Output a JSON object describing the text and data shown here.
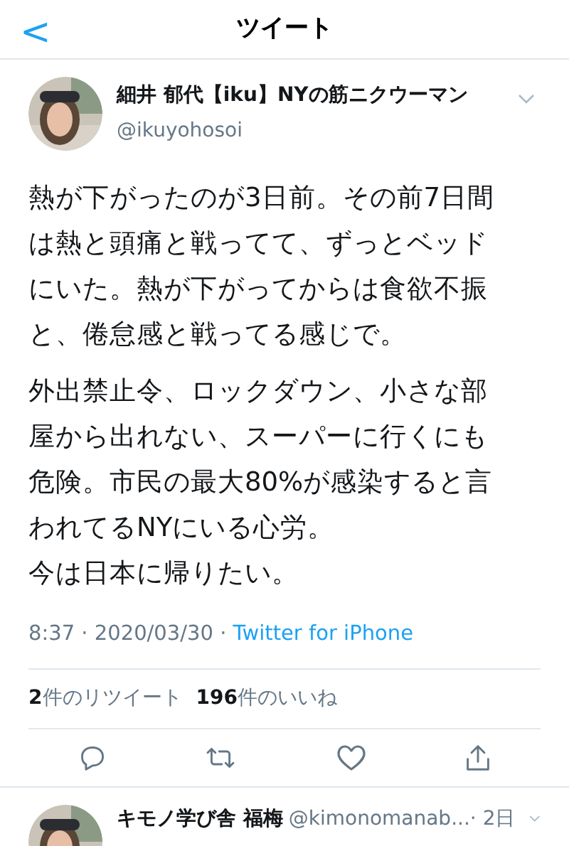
{
  "header": {
    "back": "<",
    "title": "ツイート"
  },
  "tweet": {
    "author": {
      "name": "細井 郁代【iku】NYの筋ニクウーマン",
      "handle": "@ikuyohosoi"
    },
    "paragraphs": [
      [
        "熱が下がったのが3日前。その前7日間は熱と頭痛と戦ってて、ずっとベッドにいた。熱が下がってからは食欲不振と、倦怠感と戦ってる感じで。"
      ],
      [
        "外出禁止令、ロックダウン、小さな部屋から出れない、スーパーに行くにも危険。市民の最大80%が感染すると言われてるNYにいる心労。",
        "今は日本に帰りたい。"
      ]
    ],
    "time": "8:37 · 2020/03/30 · ",
    "source": "Twitter for iPhone",
    "stats": [
      {
        "count": "2",
        "label": "件のリツイート"
      },
      {
        "count": "196",
        "label": "件のいいね"
      }
    ]
  },
  "reply": {
    "name": "キモノ学び舎 福梅",
    "handle": "@kimonomanab...",
    "age": " · 2日"
  }
}
